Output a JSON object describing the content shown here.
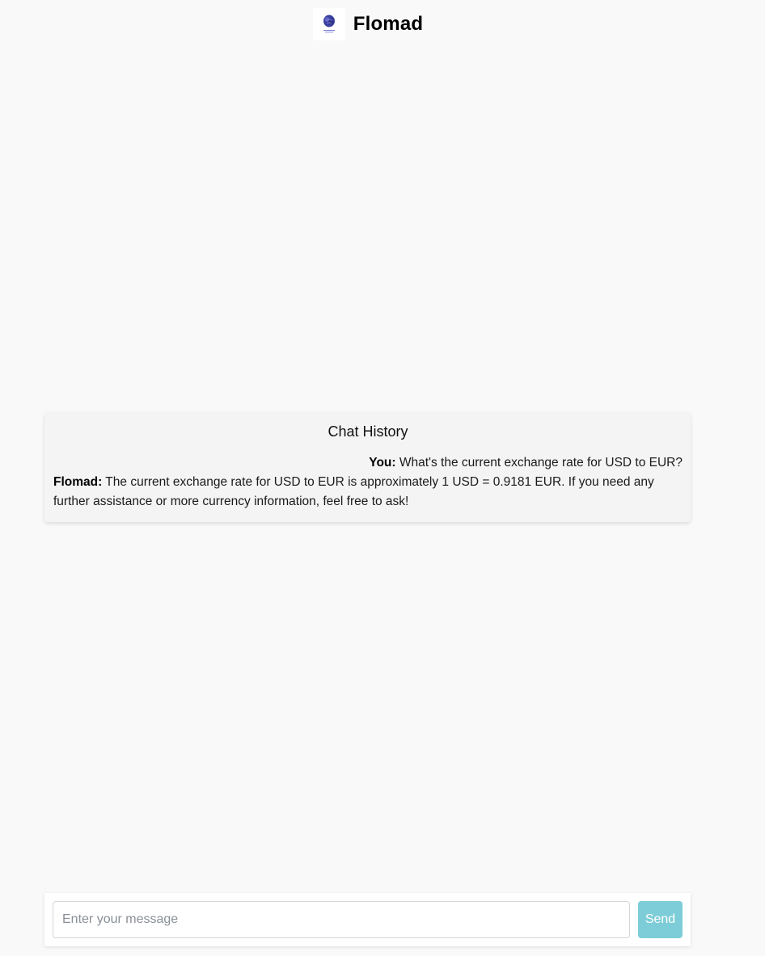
{
  "app": {
    "title": "Flomad",
    "logo_icon": "brain-logo-icon"
  },
  "chat_history": {
    "title": "Chat History",
    "messages": [
      {
        "sender": "You:",
        "text": " What's the current exchange rate for USD to EUR?",
        "align": "right"
      },
      {
        "sender": "Flomad:",
        "text": " The current exchange rate for USD to EUR is approximately 1 USD = 0.9181 EUR. If you need any further assistance or more currency information, feel free to ask!",
        "align": "left"
      }
    ]
  },
  "composer": {
    "placeholder": "Enter your message",
    "value": "",
    "send_label": "Send"
  },
  "colors": {
    "background": "#f9f9f9",
    "send_button": "#7dcdd8",
    "logo_primary": "#3a3f9e"
  }
}
